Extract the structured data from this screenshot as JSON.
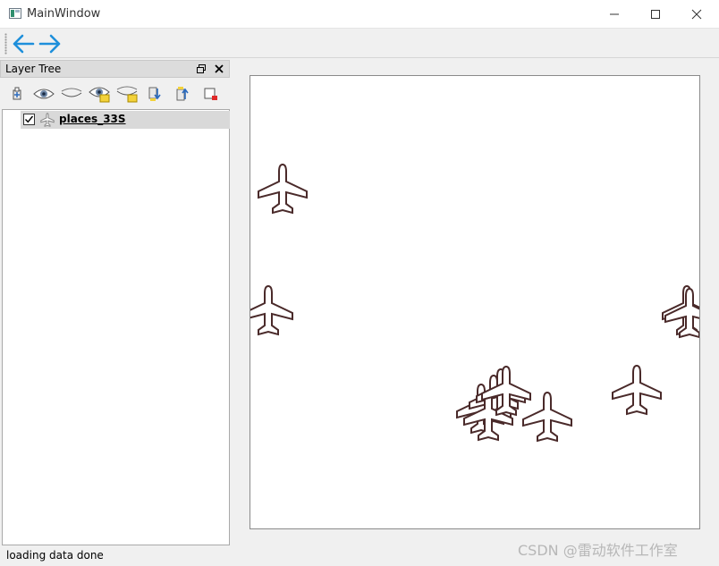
{
  "window": {
    "title": "MainWindow"
  },
  "toolbar": {
    "back_icon": "arrow-left-icon",
    "forward_icon": "arrow-right-icon",
    "accent": "#1e8fdb"
  },
  "dock": {
    "title": "Layer Tree"
  },
  "layer_tools": [
    "add-group-icon",
    "show-all-icon",
    "hide-all-icon",
    "show-selected-icon",
    "hide-selected-icon",
    "move-down-icon",
    "move-up-icon",
    "remove-layer-icon"
  ],
  "layers": [
    {
      "name": "places_33S",
      "checked": true,
      "icon": "airplane-icon"
    }
  ],
  "map": {
    "symbol": "airplane-icon",
    "symbol_stroke": "#4a2a2a",
    "feature_count": 9
  },
  "status": {
    "text": "loading data done"
  },
  "watermark": "CSDN @雷动软件工作室"
}
